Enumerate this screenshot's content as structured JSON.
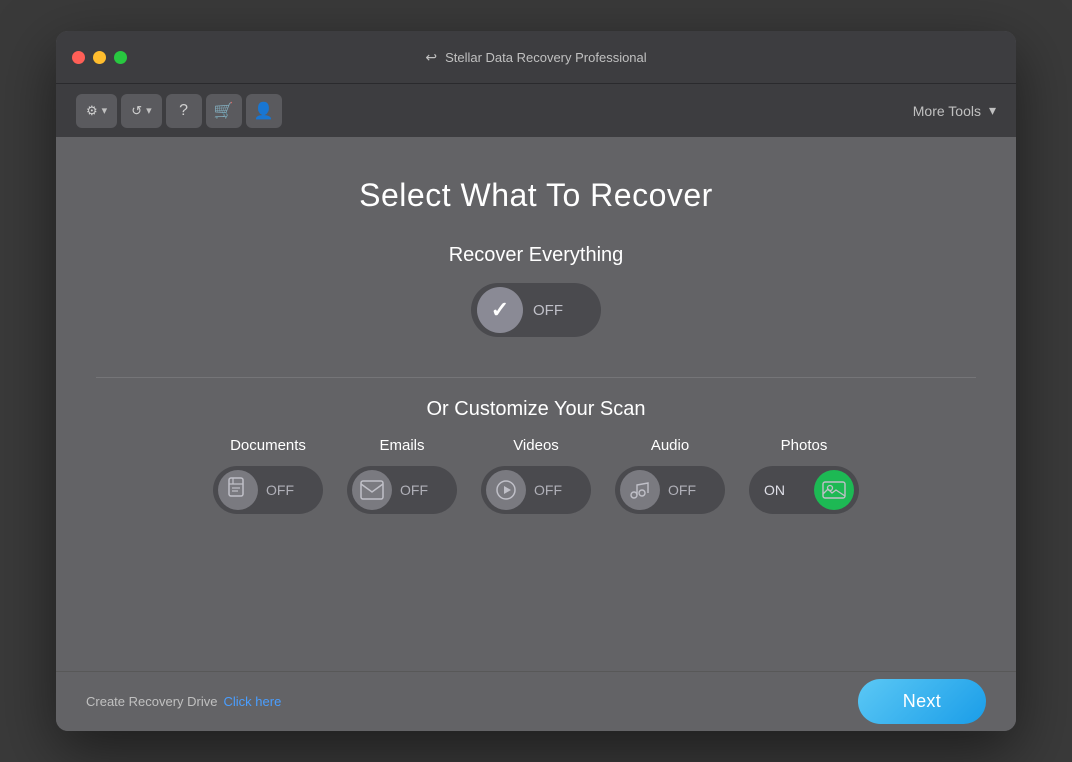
{
  "window": {
    "title": "Stellar Data Recovery Professional",
    "traffic_lights": {
      "close": "close",
      "minimize": "minimize",
      "maximize": "maximize"
    }
  },
  "toolbar": {
    "settings_label": "⚙",
    "history_label": "↺",
    "help_label": "?",
    "cart_label": "🛒",
    "account_label": "👤",
    "more_tools_label": "More Tools",
    "chevron_label": "▾"
  },
  "main": {
    "page_title": "Select What To Recover",
    "recover_everything": {
      "label": "Recover Everything",
      "toggle_state": "OFF"
    },
    "customize": {
      "label": "Or Customize Your Scan",
      "file_types": [
        {
          "name": "Documents",
          "state": "OFF",
          "icon": "doc"
        },
        {
          "name": "Emails",
          "state": "OFF",
          "icon": "email"
        },
        {
          "name": "Videos",
          "state": "OFF",
          "icon": "video"
        },
        {
          "name": "Audio",
          "state": "OFF",
          "icon": "audio"
        },
        {
          "name": "Photos",
          "state": "ON",
          "icon": "photo"
        }
      ]
    }
  },
  "bottom": {
    "recovery_drive_label": "Create Recovery Drive",
    "click_here_label": "Click here",
    "next_label": "Next"
  }
}
